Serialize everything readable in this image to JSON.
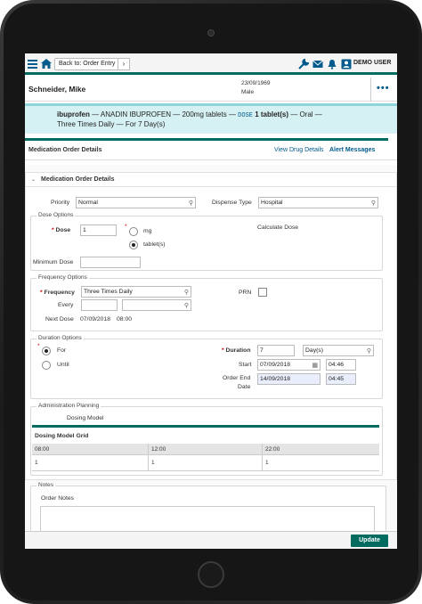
{
  "topbar": {
    "back_label": "Back to: Order Entry",
    "chevron": "›",
    "user_label": "DEMO USER",
    "icons": [
      "menu-icon",
      "home-icon",
      "wrench-icon",
      "mail-icon",
      "bell-icon",
      "user-icon",
      "more-icon"
    ]
  },
  "patient": {
    "name": "Schneider, Mike",
    "dob": "23/09/1969",
    "sex": "Male",
    "more": "•••"
  },
  "drug": {
    "line1_a": "ibuprofen",
    "line1_b": " — ANADIN IBUPROFEN — 200mg tablets — ",
    "dose_key": "DOSE",
    "line1_c": " 1 tablet(s)",
    "line1_d": " — Oral —",
    "line2": "Three Times Daily — For 7 Day(s)"
  },
  "header": {
    "title": "Medication Order Details",
    "view_drug": "View Drug Details",
    "alert_messages": "Alert Messages"
  },
  "card": {
    "title": "Medication Order Details",
    "caret": "⌄"
  },
  "fields": {
    "priority_label": "Priority",
    "priority_value": "Normal",
    "dispense_label": "Dispense Type",
    "dispense_value": "Hospital",
    "dose_options_legend": "Dose Options",
    "dose_label": "Dose",
    "dose_value": "1",
    "unit_mg": "mg",
    "unit_tablets": "tablet(s)",
    "calculate_dose": "Calculate Dose",
    "minimum_dose_label": "Minimum Dose",
    "frequency_options_legend": "Frequency Options",
    "frequency_label": "Frequency",
    "frequency_value": "Three Times Daily",
    "every_label": "Every",
    "prn_label": "PRN",
    "next_dose_label": "Next Dose",
    "next_dose_date": "07/09/2018",
    "next_dose_time": "08:00",
    "duration_options_legend": "Duration Options",
    "for_label": "For",
    "until_label": "Until",
    "duration_label": "Duration",
    "duration_value": "7",
    "duration_unit": "Day(s)",
    "start_label": "Start",
    "start_date": "07/09/2018",
    "start_time": "04:46",
    "end_label_1": "Order End",
    "end_label_2": "Date",
    "end_date": "14/09/2018",
    "end_time": "04:45",
    "admin_legend": "Administration Planning",
    "dosing_model_link": "Dosing Model"
  },
  "grid": {
    "title": "Dosing Model Grid",
    "columns": [
      "08:00",
      "12:00",
      "22:00"
    ],
    "row": [
      "1",
      "1",
      "1"
    ]
  },
  "notes": {
    "legend": "Notes",
    "order_notes_label": "Order Notes"
  },
  "footer": {
    "update_label": "Update"
  },
  "colors": {
    "accent": "#006b5e",
    "link": "#005a8c",
    "banner": "#d6f1f3"
  }
}
